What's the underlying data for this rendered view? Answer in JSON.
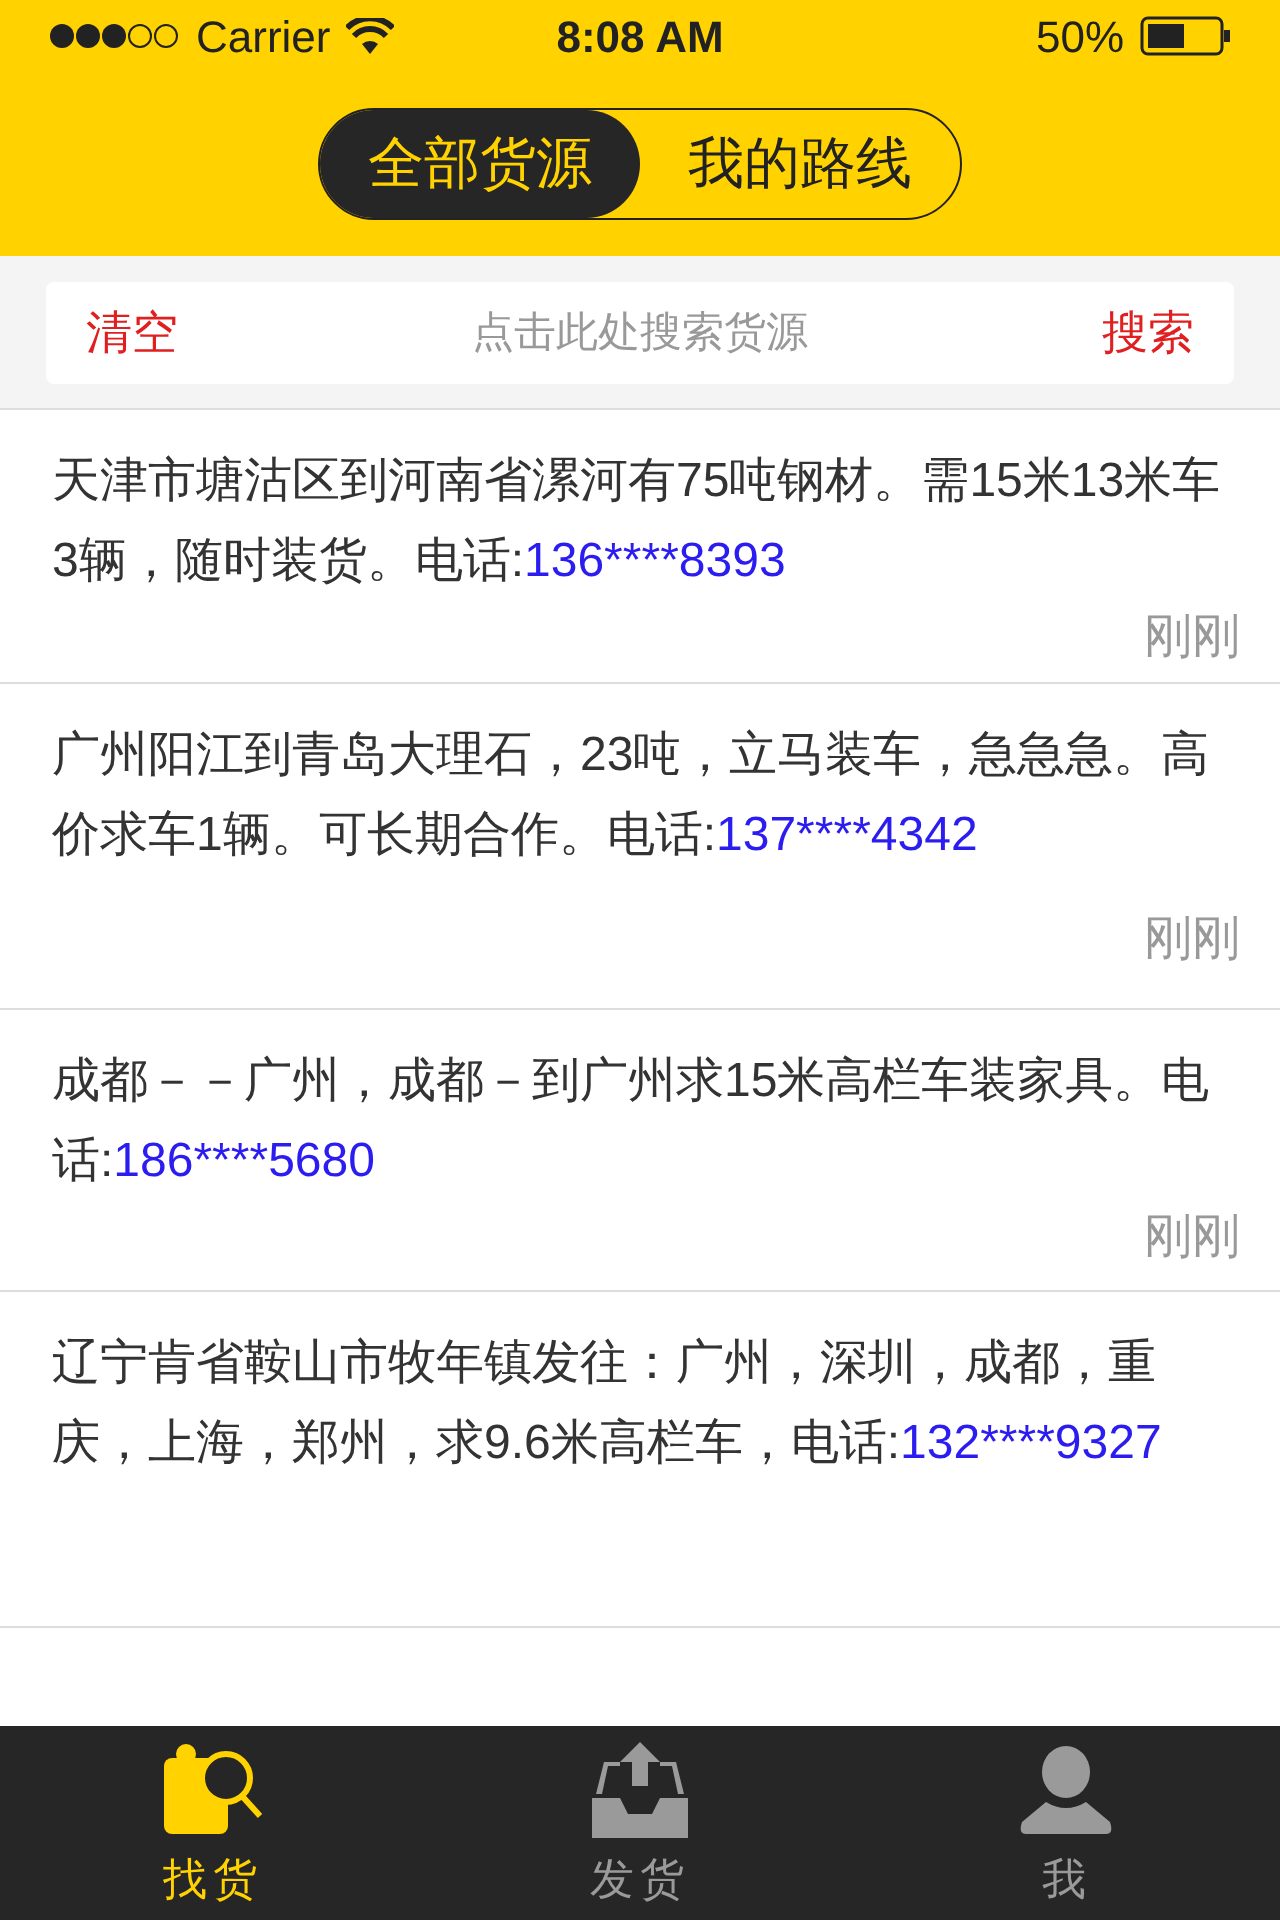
{
  "status_bar": {
    "carrier": "Carrier",
    "time": "8:08 AM",
    "battery": "50%"
  },
  "segments": [
    {
      "label": "全部货源",
      "selected": true
    },
    {
      "label": "我的路线",
      "selected": false
    }
  ],
  "search": {
    "clear": "清空",
    "placeholder": "点击此处搜索货源",
    "submit": "搜索"
  },
  "listings": [
    {
      "text": "天津市塘沽区到河南省漯河有75吨钢材。需15米13米车3辆，随时装货。电话:",
      "phone": "136****8393",
      "time": "刚刚"
    },
    {
      "text": "广州阳江到青岛大理石，23吨，立马装车，急急急。高价求车1辆。可长期合作。电话:",
      "phone": "137****4342",
      "time": "刚刚"
    },
    {
      "text": "成都－－广州，成都－到广州求15米高栏车装家具。电话:",
      "phone": "186****5680",
      "time": "刚刚"
    },
    {
      "text": "辽宁肯省鞍山市牧年镇发往：广州，深圳，成都，重庆，上海，郑州，求9.6米高栏车，电话:",
      "phone": "132****9327"
    }
  ],
  "tab_bar": [
    {
      "label": "找货",
      "kind": "find",
      "selected": true
    },
    {
      "label": "发货",
      "kind": "ship",
      "selected": false
    },
    {
      "label": "我",
      "kind": "me",
      "selected": false
    }
  ]
}
